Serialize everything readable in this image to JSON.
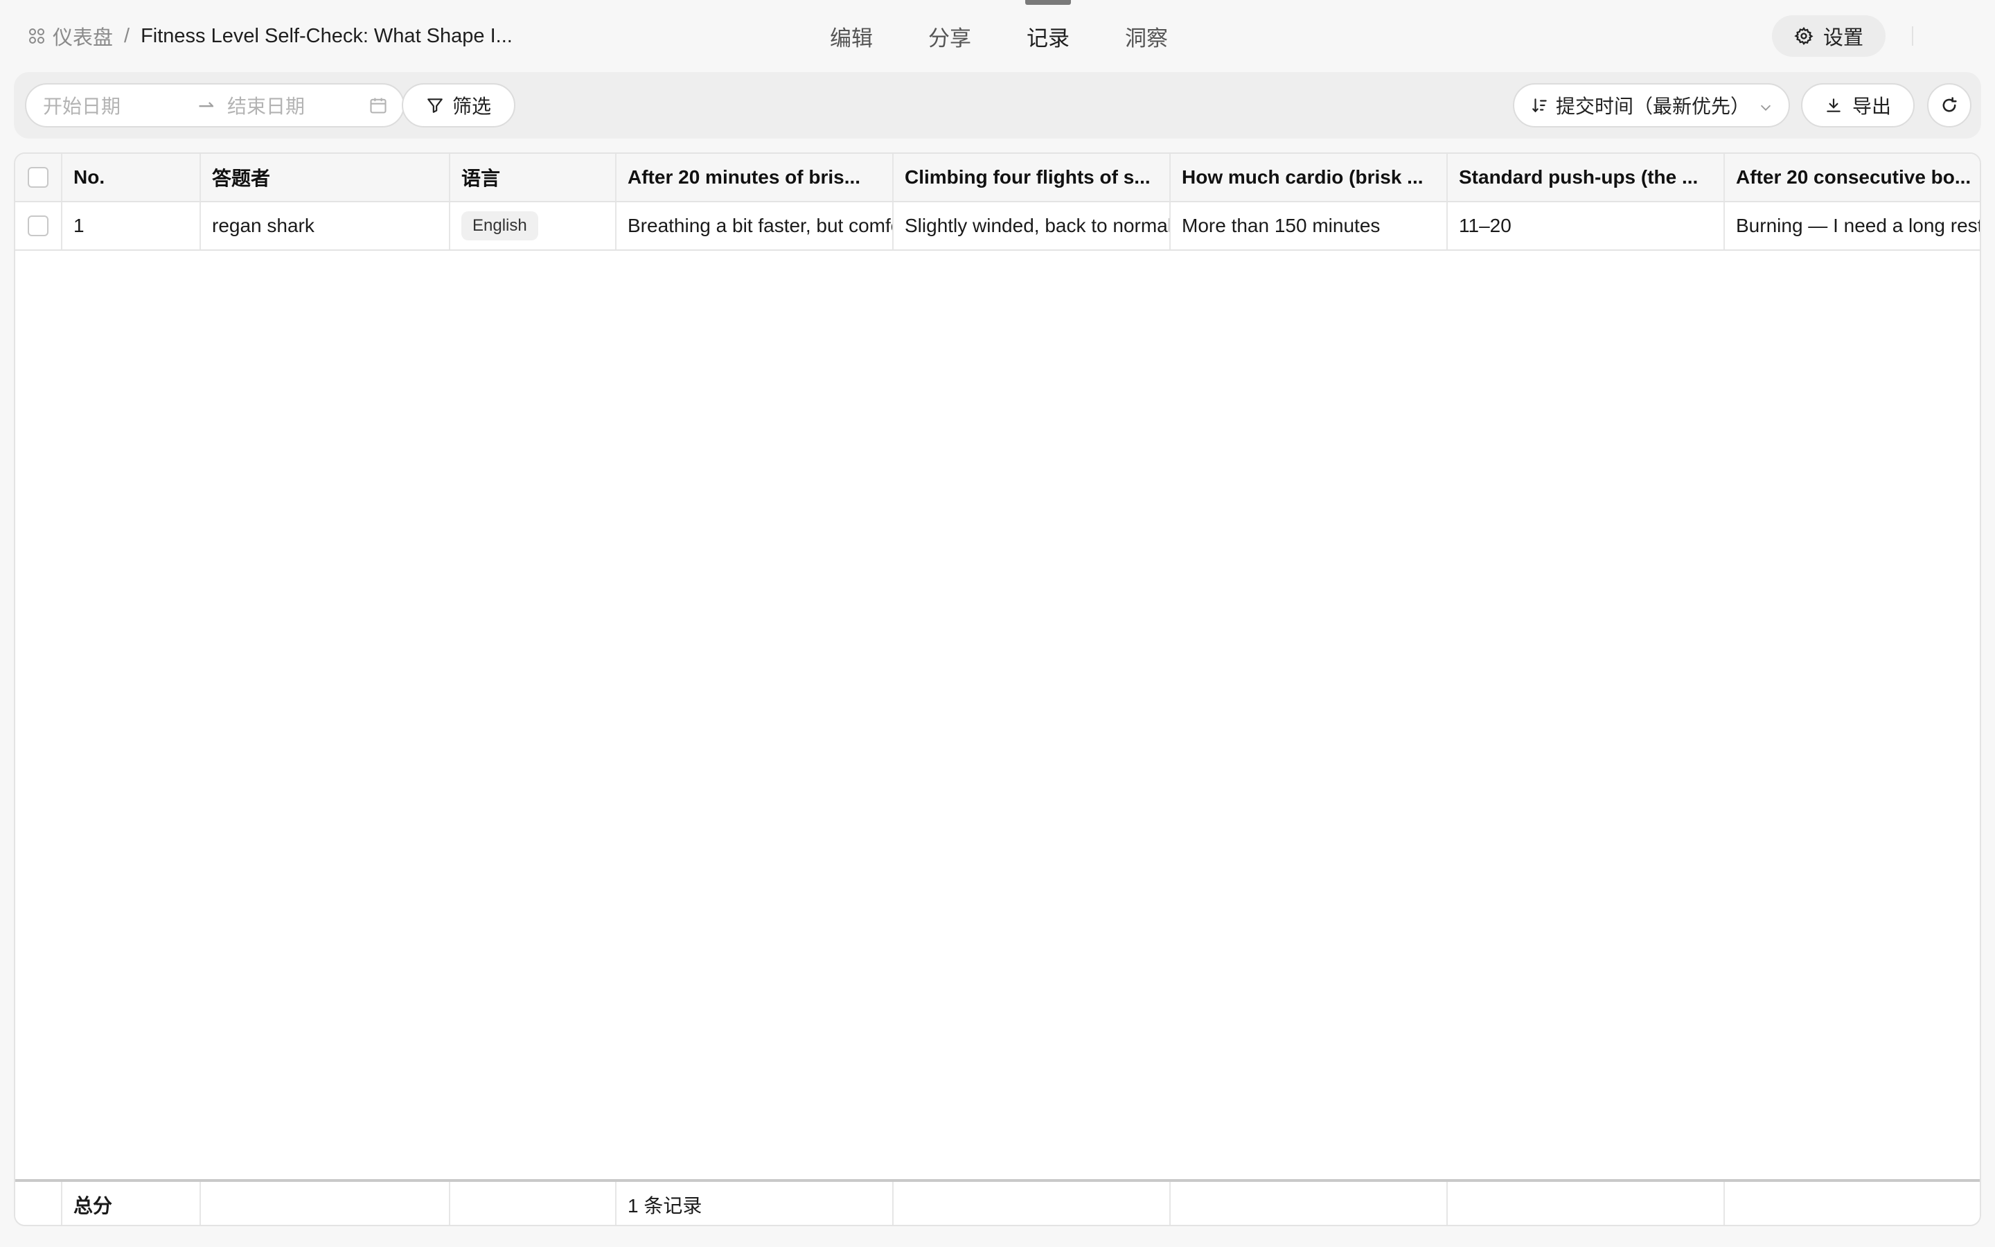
{
  "header": {
    "breadcrumb_root": "仪表盘",
    "breadcrumb_sep": "/",
    "breadcrumb_current": "Fitness Level Self-Check: What Shape I...",
    "tabs": [
      {
        "label": "编辑",
        "active": false
      },
      {
        "label": "分享",
        "active": false
      },
      {
        "label": "记录",
        "active": true
      },
      {
        "label": "洞察",
        "active": false
      }
    ],
    "settings_label": "设置"
  },
  "toolbar": {
    "start_date_placeholder": "开始日期",
    "range_arrow": "⇀",
    "end_date_placeholder": "结束日期",
    "filter_label": "筛选",
    "sort_label": "提交时间（最新优先）",
    "export_label": "导出"
  },
  "table": {
    "columns": [
      "No.",
      "答题者",
      "语言",
      "After 20 minutes of bris...",
      "Climbing four flights of s...",
      "How much cardio (brisk ...",
      "Standard push-ups (the ...",
      "After 20 consecutive bo..."
    ],
    "rows": [
      {
        "no": "1",
        "respondent": "regan shark",
        "language": "English",
        "q1": "Breathing a bit faster, but comfortable",
        "q2": "Slightly winded, back to normal quickly",
        "q3": "More than 150 minutes",
        "q4": "11–20",
        "q5": "Burning — I need a long rest"
      }
    ],
    "footer": {
      "label": "总分",
      "record_count": "1 条记录"
    }
  },
  "colors": {
    "background": "#f7f7f7",
    "active_tab_indicator": "#7a7a7a",
    "border": "#e3e3e3"
  }
}
